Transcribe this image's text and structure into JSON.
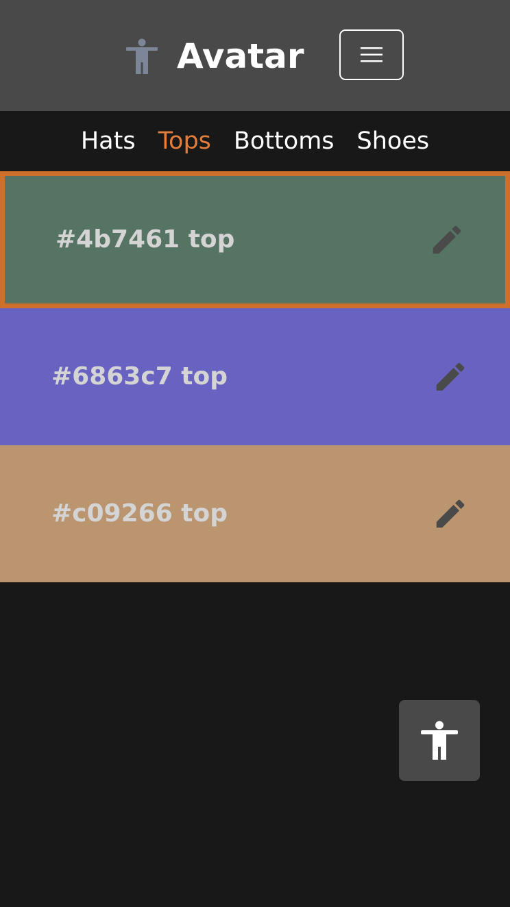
{
  "header": {
    "brand_icon": "accessibility-person-icon",
    "title": "Avatar",
    "menu_icon": "hamburger-menu-icon"
  },
  "nav": {
    "items": [
      {
        "label": "Hats",
        "active": false
      },
      {
        "label": "Tops",
        "active": true
      },
      {
        "label": "Bottoms",
        "active": false
      },
      {
        "label": "Shoes",
        "active": false
      }
    ]
  },
  "items": [
    {
      "label": "#4b7461 top",
      "color": "#557463",
      "selected": true
    },
    {
      "label": "#6863c7 top",
      "color": "#6863c1",
      "selected": false
    },
    {
      "label": "#c09266 top",
      "color": "#ba956f",
      "selected": false
    }
  ],
  "accessibility_button": {
    "icon": "accessibility-person-icon"
  },
  "colors": {
    "header_bg": "#494949",
    "page_bg": "#181818",
    "active_accent": "#e27d3b",
    "selected_border": "#cf6f2c",
    "brand_icon_color": "#7d8699",
    "edit_icon_color": "#4a4a4a"
  }
}
